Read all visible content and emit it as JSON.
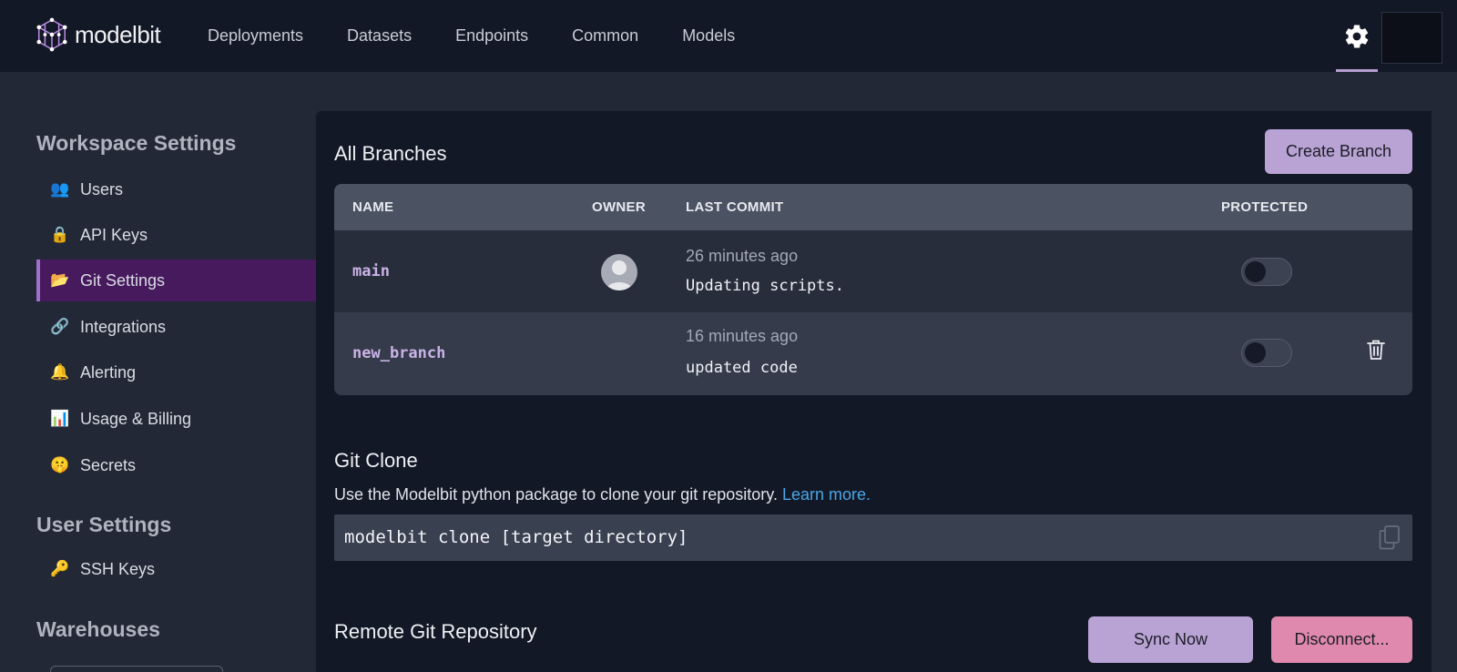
{
  "brand": {
    "name": "modelbit"
  },
  "nav": [
    {
      "label": "Deployments"
    },
    {
      "label": "Datasets"
    },
    {
      "label": "Endpoints"
    },
    {
      "label": "Common"
    },
    {
      "label": "Models"
    }
  ],
  "header": {
    "settings_icon": "gear-icon"
  },
  "sidebar": {
    "workspace_heading": "Workspace Settings",
    "workspace_items": [
      {
        "label": "Users",
        "icon": "👥"
      },
      {
        "label": "API Keys",
        "icon": "🔒"
      },
      {
        "label": "Git Settings",
        "icon": "📂",
        "active": true
      },
      {
        "label": "Integrations",
        "icon": "🔗"
      },
      {
        "label": "Alerting",
        "icon": "🔔"
      },
      {
        "label": "Usage & Billing",
        "icon": "📊"
      },
      {
        "label": "Secrets",
        "icon": "🤫"
      }
    ],
    "user_heading": "User Settings",
    "user_items": [
      {
        "label": "SSH Keys",
        "icon": "🔑"
      }
    ],
    "warehouses_heading": "Warehouses"
  },
  "branches": {
    "title": "All Branches",
    "create_button": "Create Branch",
    "columns": {
      "name": "NAME",
      "owner": "OWNER",
      "last_commit": "LAST COMMIT",
      "protected": "PROTECTED"
    },
    "rows": [
      {
        "name": "main",
        "has_owner": true,
        "time_ago": "26 minutes ago",
        "message": "Updating scripts.",
        "protected": false,
        "deletable": false
      },
      {
        "name": "new_branch",
        "has_owner": false,
        "time_ago": "16 minutes ago",
        "message": "updated code",
        "protected": false,
        "deletable": true
      }
    ]
  },
  "git_clone": {
    "title": "Git Clone",
    "description": "Use the Modelbit python package to clone your git repository.",
    "learn_more": "Learn more.",
    "command": "modelbit clone [target directory]"
  },
  "remote_repo": {
    "title": "Remote Git Repository",
    "sync_button": "Sync Now",
    "disconnect_button": "Disconnect..."
  },
  "colors": {
    "accent": "#b9a3d4",
    "danger": "#e089ae",
    "active_nav": "#471a5e",
    "link": "#4aa7e8"
  }
}
